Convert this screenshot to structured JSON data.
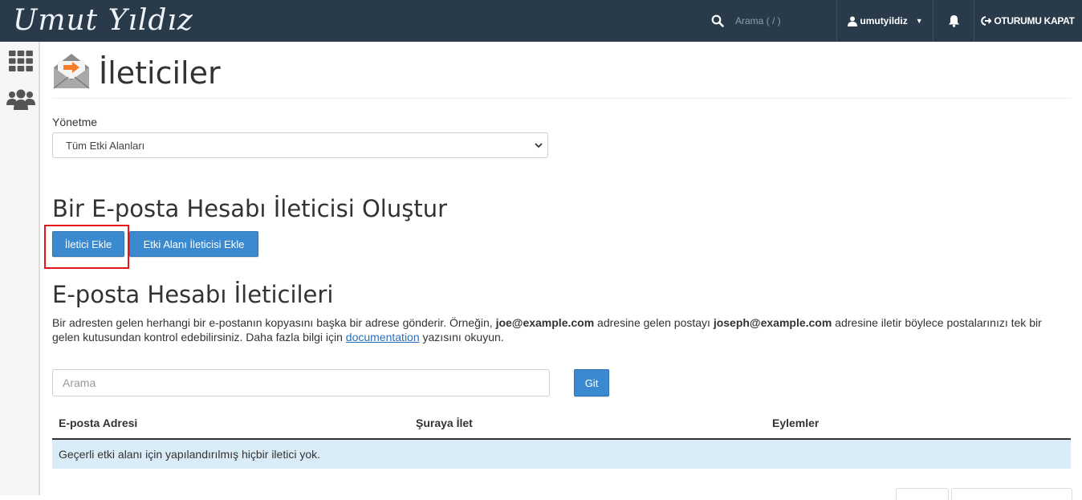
{
  "topbar": {
    "brand": "Umut Yıldız",
    "search_placeholder": "Arama ( / )",
    "username": "umutyildiz",
    "logout_label": "OTURUMU KAPAT"
  },
  "page": {
    "title": "İleticiler",
    "manage_label": "Yönetme",
    "domain_select_value": "Tüm Etki Alanları"
  },
  "create": {
    "heading": "Bir E-posta Hesabı İleticisi Oluştur",
    "add_forwarder": "İletici Ekle",
    "add_domain_forwarder": "Etki Alanı İleticisi Ekle"
  },
  "list": {
    "heading": "E-posta Hesabı İleticileri",
    "desc_part1": "Bir adresten gelen herhangi bir e-postanın kopyasını başka bir adrese gönderir. Örneğin, ",
    "desc_email1": "joe@example.com",
    "desc_part2": " adresine gelen postayı ",
    "desc_email2": "joseph@example.com",
    "desc_part3": " adresine iletir böylece postalarınızı tek bir gelen kutusundan kontrol edebilirsiniz. Daha fazla bilgi için ",
    "desc_link": "documentation",
    "desc_part4": " yazısını okuyun.",
    "search_placeholder": "Arama",
    "go_button": "Git",
    "columns": [
      "E-posta Adresi",
      "Şuraya İlet",
      "Eylemler"
    ],
    "empty_message": "Geçerli etki alanı için yapılandırılmış hiçbir iletici yok."
  },
  "colors": {
    "topbar": "#293a4a",
    "primary": "#3b8ad0",
    "empty_row": "#d9ecf7",
    "highlight": "#e3151a"
  }
}
